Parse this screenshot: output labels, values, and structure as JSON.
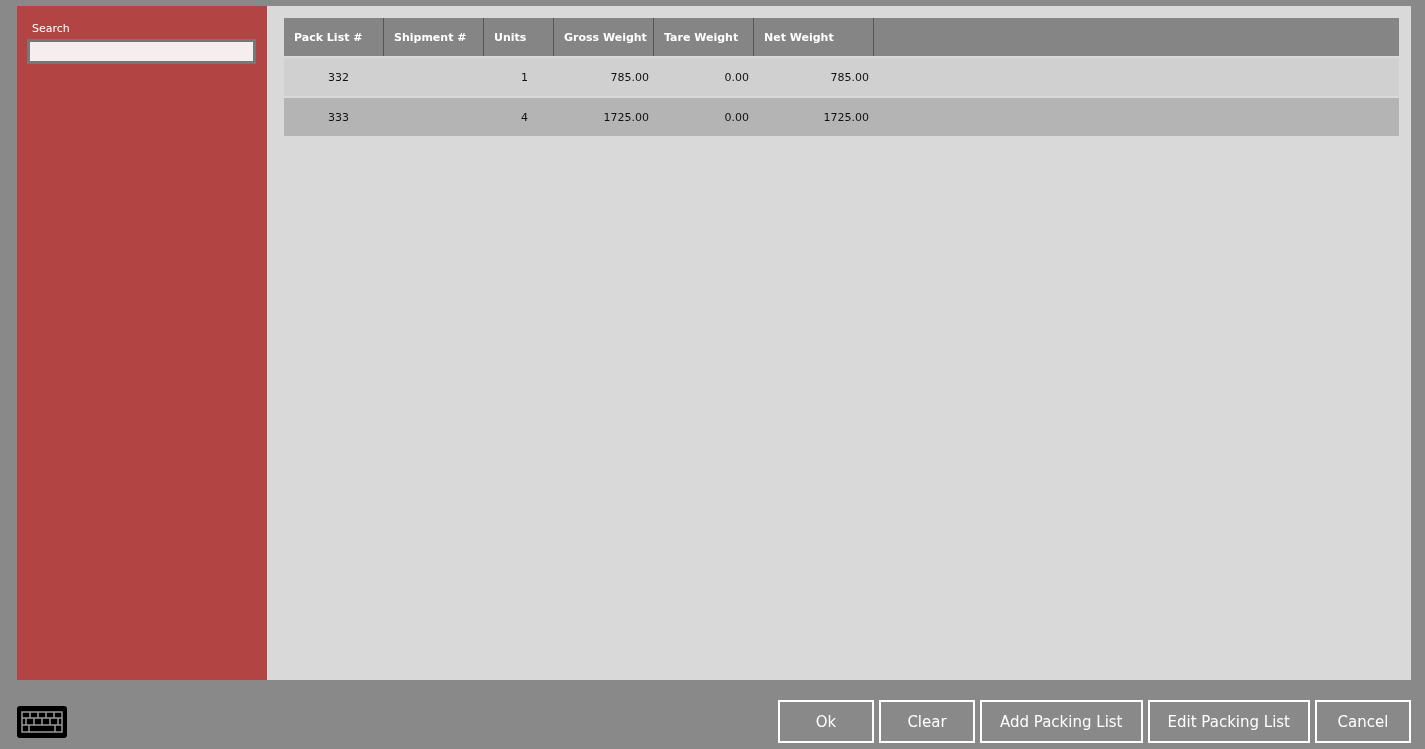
{
  "search": {
    "label": "Search"
  },
  "table": {
    "columns": [
      "Pack List #",
      "Shipment #",
      "Units",
      "Gross Weight",
      "Tare Weight",
      "Net Weight"
    ],
    "rows": [
      [
        "332",
        "",
        "1",
        "785.00",
        "0.00",
        "785.00"
      ],
      [
        "333",
        "",
        "4",
        "1725.00",
        "0.00",
        "1725.00"
      ]
    ]
  },
  "buttons": [
    "Ok",
    "Clear",
    "Add Packing List",
    "Edit Packing List",
    "Cancel"
  ]
}
